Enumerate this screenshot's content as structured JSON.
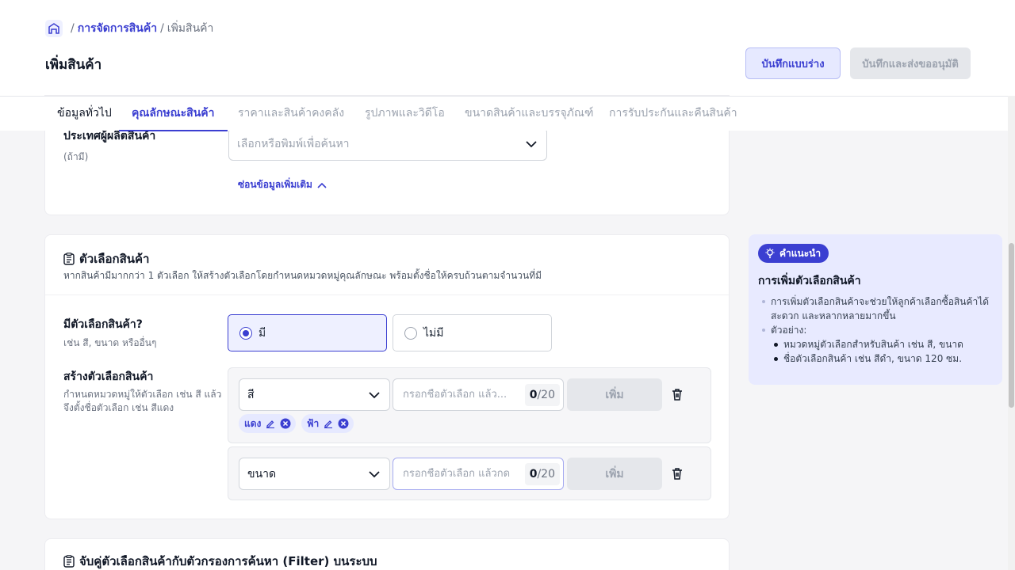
{
  "breadcrumb": {
    "separator": "/",
    "parent": "การจัดการสินค้า",
    "current": "เพิ่มสินค้า"
  },
  "page": {
    "title": "เพิ่มสินค้า"
  },
  "actions": {
    "save_draft": "บันทึกแบบร่าง",
    "save_submit": "บันทึกและส่งขออนุมัติ"
  },
  "tabs": [
    {
      "label": "ข้อมูลทั่วไป"
    },
    {
      "label": "คุณลักษณะสินค้า"
    },
    {
      "label": "ราคาและสินค้าคงคลัง"
    },
    {
      "label": "รูปภาพและวิดีโอ"
    },
    {
      "label": "ขนาดสินค้าและบรรจุภัณฑ์"
    },
    {
      "label": "การรับประกันและคืนสินค้า"
    }
  ],
  "origin": {
    "label": "ประเทศผู้ผลิตสินค้า",
    "optional": "(ถ้ามี)",
    "placeholder": "เลือกหรือพิมพ์เพื่อค้นหา",
    "toggle_label": "ซ่อนข้อมูลเพิ่มเติม"
  },
  "variants": {
    "title": "ตัวเลือกสินค้า",
    "description": "หากสินค้ามีมากกว่า 1 ตัวเลือก ให้สร้างตัวเลือกโดยกำหนดหมวดหมู่คุณลักษณะ พร้อมตั้งชื่อให้ครบถ้วนตามจำนวนที่มี",
    "has_label": "มีตัวเลือกสินค้า?",
    "has_hint": "เช่น สี, ขนาด หรืออื่นๆ",
    "option_yes": "มี",
    "option_no": "ไม่มี",
    "selected": "มี",
    "create_label": "สร้างตัวเลือกสินค้า",
    "create_hint_1": "กำหนดหมวดหมู่ให้ตัวเลือก เช่น สี แล้ว",
    "create_hint_2": "จึงตั้งชื่อตัวเลือก เช่น สีแดง",
    "groups": [
      {
        "category": "สี",
        "placeholder": "กรอกชื่อตัวเลือก แล้ว...",
        "count": "0",
        "max": "20",
        "add_label": "เพิ่ม",
        "chips": [
          "แดง",
          "ฟ้า"
        ]
      },
      {
        "category": "ขนาด",
        "placeholder": "กรอกชื่อตัวเลือก แล้วกด",
        "count": "0",
        "max": "20",
        "add_label": "เพิ่ม",
        "chips": []
      }
    ]
  },
  "filter_section": {
    "title": "จับคู่ตัวเลือกสินค้ากับตัวกรองการค้นหา (Filter) บนระบบ"
  },
  "tip": {
    "badge": "คำแนะนำ",
    "title": "การเพิ่มตัวเลือกสินค้า",
    "bullet_1": "การเพิ่มตัวเลือกสินค้าจะช่วยให้ลูกค้าเลือกซื้อสินค้าได้สะดวก และหลากหลายมากขึ้น",
    "bullet_2": "ตัวอย่าง:",
    "sub_1": "หมวดหมู่ตัวเลือกสำหรับสินค้า เช่น สี, ขนาด",
    "sub_2": "ชื่อตัวเลือกสินค้า เช่น สีดำ, ขนาด 120 ซม."
  },
  "colors": {
    "accent": "#3b3fd1",
    "accent_light": "#e6e9ff",
    "tip_bg": "#e8eaff"
  },
  "icons": [
    "home-icon",
    "chevron-down-icon",
    "chevron-up-icon",
    "clipboard-icon",
    "edit-icon",
    "close-circle-icon",
    "trash-icon",
    "lightbulb-icon"
  ]
}
